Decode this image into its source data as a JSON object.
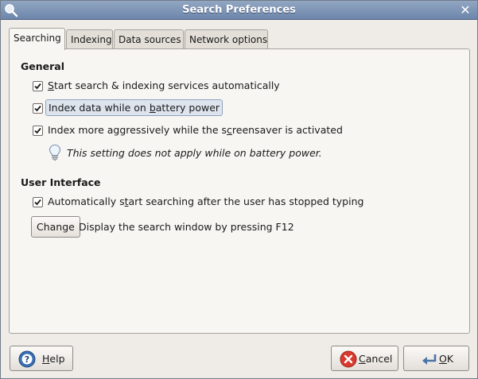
{
  "window": {
    "title": "Search Preferences"
  },
  "tabs": [
    {
      "label": "Searching"
    },
    {
      "label": "Indexing"
    },
    {
      "label": "Data sources"
    },
    {
      "label": "Network options"
    }
  ],
  "general": {
    "title": "General",
    "options": [
      {
        "pre": "",
        "u": "S",
        "post": "tart search & indexing services automatically",
        "checked": true
      },
      {
        "pre": "Index data while on ",
        "u": "b",
        "post": "attery power",
        "checked": true
      },
      {
        "pre": "Index more aggressively while the s",
        "u": "c",
        "post": "reensaver is activated",
        "checked": true
      }
    ],
    "hint": "This setting does not apply while on battery power."
  },
  "ui": {
    "title": "User Interface",
    "option": {
      "pre": "Automatically s",
      "u": "t",
      "post": "art searching after the user has stopped typing",
      "checked": true
    },
    "change_label": "Change",
    "shortcut_text": "Display the search window by pressing F12"
  },
  "buttons": {
    "help": {
      "u": "H",
      "rest": "elp"
    },
    "cancel": {
      "u": "C",
      "rest": "ancel"
    },
    "ok": {
      "u": "O",
      "rest": "K"
    }
  },
  "colors": {
    "titlebar": "#7b93b6",
    "accent_check": "#1a1a1a",
    "cancel_icon": "#d83a2e",
    "help_icon": "#3a6fb3"
  },
  "icons": {
    "app": "search-icon",
    "close": "close-icon",
    "hint": "lightbulb-icon",
    "help": "help-icon",
    "cancel": "cancel-icon",
    "ok": "ok-icon"
  }
}
